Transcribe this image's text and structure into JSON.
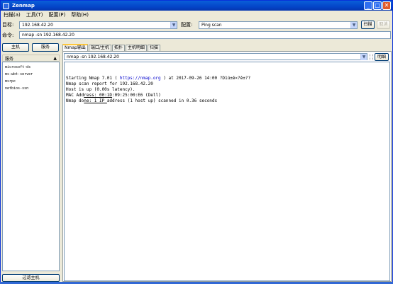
{
  "window": {
    "title": "Zenmap"
  },
  "menu": [
    "扫描(a)",
    "工具(T)",
    "配置(P)",
    "帮助(H)"
  ],
  "target": {
    "label": "目标:",
    "value": "192.168.42.20"
  },
  "profile": {
    "label": "配置:",
    "value": "Ping scan"
  },
  "scan_button": "扫描",
  "cancel_button": "取消",
  "command": {
    "label": "命令:",
    "value": "nmap -sn 192.168.42.20"
  },
  "left": {
    "hosts_button": "主机",
    "services_button": "服务",
    "services_header": "服务",
    "services": [
      "microsoft-ds",
      "ms-wbt-server",
      "msrpc",
      "netbios-ssn"
    ],
    "filter_button": "过滤主机"
  },
  "tabs": [
    "Nmap输出",
    "端口/主机",
    "拓扑",
    "主机明细",
    "扫描"
  ],
  "output": {
    "command_value": "nmap -sn 192.168.42.20",
    "details_button": "明细",
    "line1_pre": "Starting Nmap 7.01 ( ",
    "line1_url": "https://nmap.org",
    "line1_post": " ) at 2017-09-26 14:00 ?D1ú±ê×?ê±??",
    "line2": "Nmap scan report for 192.168.42.20",
    "line3": "Host is up (0.00s latency).",
    "line4_pre": "MAC Add",
    "line4_ul": "ress: 00:1D",
    "line4_post": ":09:25:00:E6 (Dell)",
    "line5_pre": "Nmap do",
    "line5_ul": "ne: 1 IP ",
    "line5_post": "address (1 host up) scanned in 0.36 seconds"
  }
}
